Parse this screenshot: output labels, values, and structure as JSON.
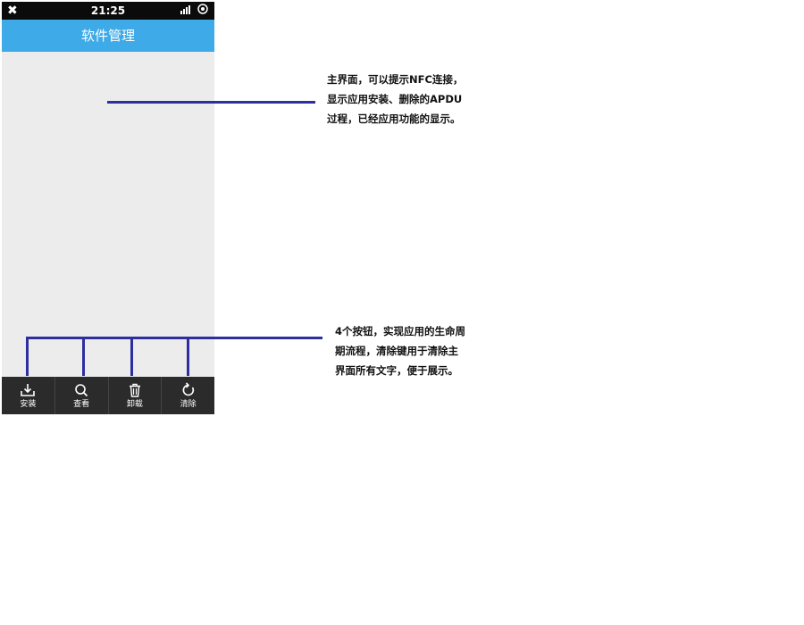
{
  "status_bar": {
    "time": "21:25",
    "left_icon": "✖",
    "signal_icon": "signal-icon",
    "battery_icon": "battery-icon"
  },
  "title": "软件管理",
  "toolbar": {
    "buttons": [
      {
        "label": "安装",
        "icon": "download-tray-icon"
      },
      {
        "label": "查看",
        "icon": "search-icon"
      },
      {
        "label": "卸载",
        "icon": "trash-icon"
      },
      {
        "label": "清除",
        "icon": "refresh-icon"
      }
    ]
  },
  "annotations": {
    "main_screen": {
      "lines": [
        "主界面，可以提示NFC连接，",
        "显示应用安装、删除的APDU",
        "过程，已经应用功能的显示。"
      ]
    },
    "buttons": {
      "lines": [
        "4个按钮，实现应用的生命周",
        "期流程，清除键用于清除主",
        "界面所有文字，便于展示。"
      ]
    }
  },
  "colors": {
    "title_bar": "#3eaae7",
    "toolbar": "#2b2b2b",
    "annotation_line": "#2e2f9e",
    "content_bg": "#ececec"
  }
}
